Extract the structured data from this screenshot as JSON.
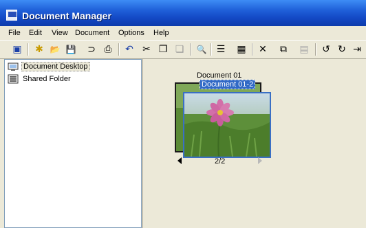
{
  "window": {
    "title": "Document Manager"
  },
  "menu": [
    "File",
    "Edit",
    "View",
    "Document",
    "Options",
    "Help"
  ],
  "toolbar": [
    {
      "name": "desktop-icon",
      "glyph": "▣"
    },
    {
      "name": "new-folder-icon",
      "glyph": "✱"
    },
    {
      "name": "open-icon",
      "glyph": "📂"
    },
    {
      "name": "save-icon",
      "glyph": "💾"
    },
    {
      "name": "scan-icon",
      "glyph": "⊃"
    },
    {
      "name": "print-icon",
      "glyph": "⎙"
    },
    {
      "name": "undo-icon",
      "glyph": "↶"
    },
    {
      "name": "cut-icon",
      "glyph": "✂"
    },
    {
      "name": "copy-icon",
      "glyph": "❐"
    },
    {
      "name": "paste-icon",
      "glyph": "❏"
    },
    {
      "name": "zoom-icon",
      "glyph": "🔍"
    },
    {
      "name": "list-view-icon",
      "glyph": "☰"
    },
    {
      "name": "thumbnail-view-icon",
      "glyph": "▦"
    },
    {
      "name": "delete-icon",
      "glyph": "✕"
    },
    {
      "name": "properties-icon",
      "glyph": "⧉"
    },
    {
      "name": "disabled-icon",
      "glyph": "▤"
    },
    {
      "name": "rotate-left-icon",
      "glyph": "↺"
    },
    {
      "name": "rotate-right-icon",
      "glyph": "↻"
    },
    {
      "name": "next-page-icon",
      "glyph": "⇥"
    }
  ],
  "tree": [
    {
      "label": "Document Desktop",
      "icon": "desktop-tree-icon",
      "selected": true
    },
    {
      "label": "Shared Folder",
      "icon": "shared-folder-icon",
      "selected": false
    }
  ],
  "documents": {
    "back_title": "Document 01",
    "front_title": "Document 01-2",
    "page_indicator": "2/2"
  }
}
